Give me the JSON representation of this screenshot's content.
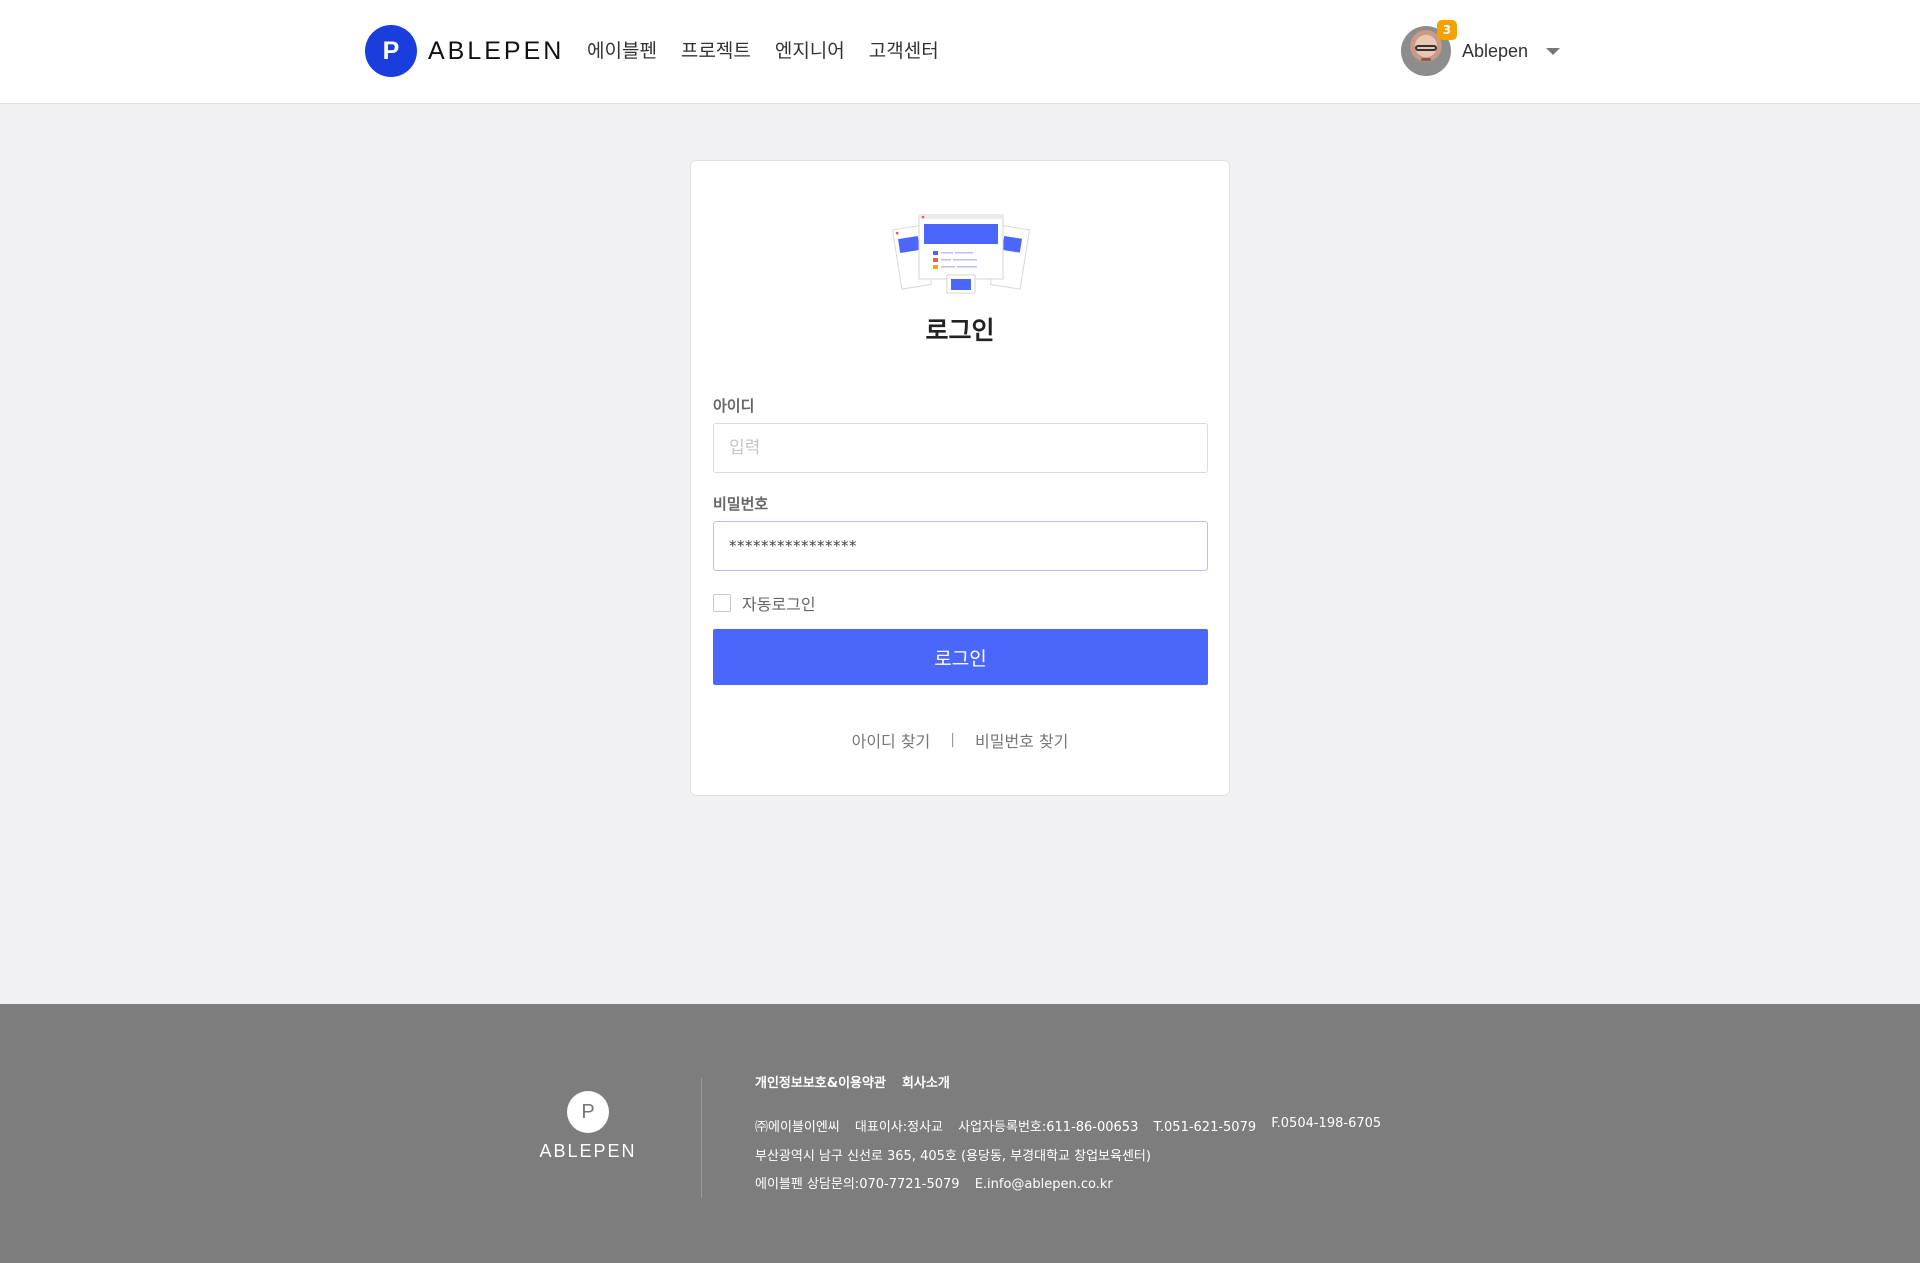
{
  "header": {
    "logo_letter": "P",
    "logo_text": "ABLEPEN",
    "nav": [
      "에이블펜",
      "프로젝트",
      "엔지니어",
      "고객센터"
    ],
    "user": {
      "name": "Ablepen",
      "notification_count": "3"
    }
  },
  "login": {
    "title": "로그인",
    "id_label": "아이디",
    "id_placeholder": "입력",
    "id_value": "",
    "pw_label": "비밀번호",
    "pw_value": "****************",
    "remember_label": "자동로그인",
    "remember_checked": false,
    "submit_label": "로그인",
    "find_id": "아이디 찾기",
    "find_pw": "비밀번호 찾기"
  },
  "footer": {
    "logo_letter": "P",
    "logo_text": "ABLEPEN",
    "links": [
      "개인정보보호&이용약관",
      "회사소개"
    ],
    "company": "㈜에이블이엔씨",
    "ceo": "대표이사:정사교",
    "biz_no": "사업자등록번호:611-86-00653",
    "tel": "T.051-621-5079",
    "fax": "F.0504-198-6705",
    "address": "부산광역시 남구 신선로 365, 405호 (용당동, 부경대학교 창업보육센터)",
    "contact": "에이블펜 상담문의:070-7721-5079",
    "email": "E.info@ablepen.co.kr"
  },
  "colors": {
    "brand": "#1a3ede",
    "button": "#4a66fb",
    "badge": "#f5a100",
    "footer_bg": "#7d7d7d",
    "page_bg": "#f1f1f3"
  },
  "icons": [
    "caret-down-icon",
    "avatar"
  ]
}
